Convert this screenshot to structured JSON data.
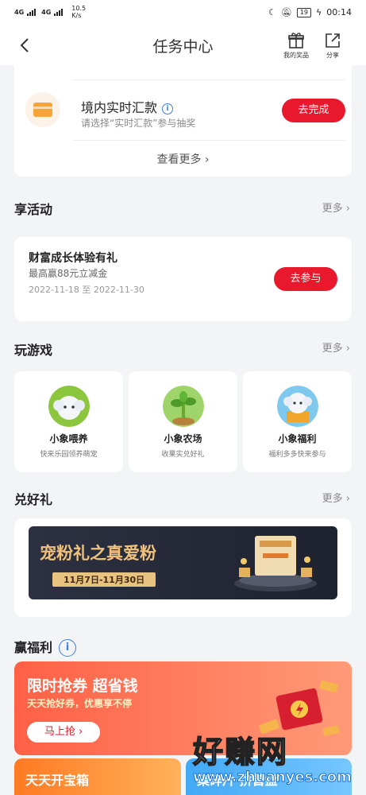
{
  "status_bar": {
    "signal_1": "4G",
    "signal_2": "4G",
    "speed_value": "10.5",
    "speed_unit": "K/s",
    "battery": "19",
    "time": "00:14"
  },
  "nav": {
    "title": "任务中心",
    "my_prizes": "我的奖品",
    "share": "分享"
  },
  "task": {
    "title": "境内实时汇款",
    "info": "i",
    "desc": "请选择“实时汇款”参与抽奖",
    "button": "去完成",
    "see_more": "查看更多"
  },
  "activity_section": {
    "title": "享活动",
    "more": "更多"
  },
  "activity": {
    "title": "财富成长体验有礼",
    "sub": "最高赢88元立减金",
    "date": "2022-11-18 至 2022-11-30",
    "button": "去参与"
  },
  "game_section": {
    "title": "玩游戏",
    "more": "更多"
  },
  "games": [
    {
      "name": "小象喂养",
      "desc": "快来乐园领养萌宠"
    },
    {
      "name": "小象农场",
      "desc": "收果实兑好礼"
    },
    {
      "name": "小象福利",
      "desc": "福利多多快来参与"
    }
  ],
  "gift_section": {
    "title": "兑好礼",
    "more": "更多"
  },
  "gift_banner": {
    "title": "宠粉礼之真爱粉",
    "date": "11月7日-11月30日"
  },
  "benefit_section": {
    "title": "赢福利",
    "info": "i"
  },
  "benefit": {
    "title": "限时抢券 超省钱",
    "sub": "天天抢好券，优惠享不停",
    "button": "马上抢"
  },
  "bottom_cards": [
    {
      "label": "天天开宝箱"
    },
    {
      "label": "集碎片 拼首盘"
    }
  ],
  "watermark": {
    "text": "好赚网",
    "url": "www.zhuanyes.com"
  },
  "colors": {
    "accent_red": "#e8192c",
    "info_blue": "#3d7ee6"
  }
}
